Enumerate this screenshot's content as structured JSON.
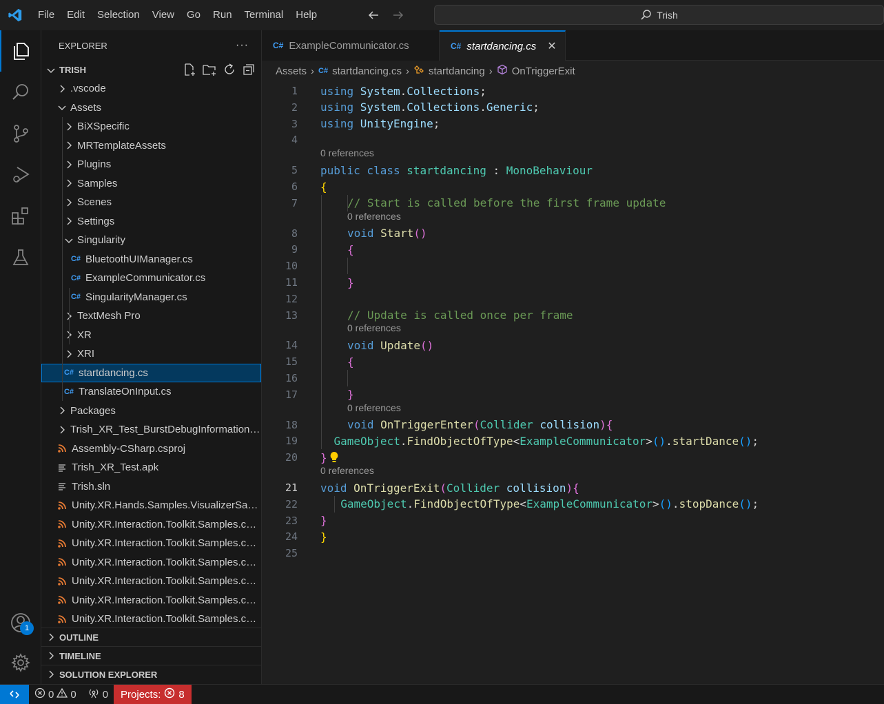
{
  "menu": [
    "File",
    "Edit",
    "Selection",
    "View",
    "Go",
    "Run",
    "Terminal",
    "Help"
  ],
  "search": {
    "label": "Trish"
  },
  "activity": {
    "accounts_badge": "1"
  },
  "sidebar": {
    "title": "EXPLORER",
    "more": "···",
    "folder": "TRISH",
    "tree": [
      {
        "label": ".vscode",
        "type": "folder",
        "depth": 1,
        "expanded": false
      },
      {
        "label": "Assets",
        "type": "folder",
        "depth": 1,
        "expanded": true
      },
      {
        "label": "BiXSpecific",
        "type": "folder",
        "depth": 2,
        "expanded": false
      },
      {
        "label": "MRTemplateAssets",
        "type": "folder",
        "depth": 2,
        "expanded": false
      },
      {
        "label": "Plugins",
        "type": "folder",
        "depth": 2,
        "expanded": false
      },
      {
        "label": "Samples",
        "type": "folder",
        "depth": 2,
        "expanded": false
      },
      {
        "label": "Scenes",
        "type": "folder",
        "depth": 2,
        "expanded": false
      },
      {
        "label": "Settings",
        "type": "folder",
        "depth": 2,
        "expanded": false
      },
      {
        "label": "Singularity",
        "type": "folder",
        "depth": 2,
        "expanded": true
      },
      {
        "label": "BluetoothUIManager.cs",
        "type": "cs",
        "depth": 3
      },
      {
        "label": "ExampleCommunicator.cs",
        "type": "cs",
        "depth": 3
      },
      {
        "label": "SingularityManager.cs",
        "type": "cs",
        "depth": 3
      },
      {
        "label": "TextMesh Pro",
        "type": "folder",
        "depth": 2,
        "expanded": false
      },
      {
        "label": "XR",
        "type": "folder",
        "depth": 2,
        "expanded": false
      },
      {
        "label": "XRI",
        "type": "folder",
        "depth": 2,
        "expanded": false
      },
      {
        "label": "startdancing.cs",
        "type": "cs",
        "depth": 2,
        "selected": true
      },
      {
        "label": "TranslateOnInput.cs",
        "type": "cs",
        "depth": 2
      },
      {
        "label": "Packages",
        "type": "folder",
        "depth": 1,
        "expanded": false
      },
      {
        "label": "Trish_XR_Test_BurstDebugInformation_DoNotShip",
        "type": "folder",
        "depth": 1,
        "expanded": false
      },
      {
        "label": "Assembly-CSharp.csproj",
        "type": "rss",
        "depth": 1
      },
      {
        "label": "Trish_XR_Test.apk",
        "type": "plain",
        "depth": 1
      },
      {
        "label": "Trish.sln",
        "type": "plain",
        "depth": 1
      },
      {
        "label": "Unity.XR.Hands.Samples.VisualizerSample.csproj",
        "type": "rss",
        "depth": 1
      },
      {
        "label": "Unity.XR.Interaction.Toolkit.Samples.csproj",
        "type": "rss",
        "depth": 1
      },
      {
        "label": "Unity.XR.Interaction.Toolkit.Samples.csproj",
        "type": "rss",
        "depth": 1
      },
      {
        "label": "Unity.XR.Interaction.Toolkit.Samples.csproj",
        "type": "rss",
        "depth": 1
      },
      {
        "label": "Unity.XR.Interaction.Toolkit.Samples.csproj",
        "type": "rss",
        "depth": 1
      },
      {
        "label": "Unity.XR.Interaction.Toolkit.Samples.csproj",
        "type": "rss",
        "depth": 1
      },
      {
        "label": "Unity.XR.Interaction.Toolkit.Samples.csproj",
        "type": "rss",
        "depth": 1
      }
    ],
    "panels": [
      "OUTLINE",
      "TIMELINE",
      "SOLUTION EXPLORER"
    ]
  },
  "tabs": [
    {
      "label": "ExampleCommunicator.cs",
      "active": false
    },
    {
      "label": "startdancing.cs",
      "active": true
    }
  ],
  "breadcrumb": [
    "Assets",
    "startdancing.cs",
    "startdancing",
    "OnTriggerExit"
  ],
  "code": {
    "lens": "0 references",
    "current_line": 21,
    "lines": [
      {
        "n": 1,
        "indent": 0,
        "tokens": [
          [
            "kw",
            "using "
          ],
          [
            "ns",
            "System"
          ],
          [
            "df",
            "."
          ],
          [
            "ns",
            "Collections"
          ],
          [
            "df",
            ";"
          ]
        ]
      },
      {
        "n": 2,
        "indent": 0,
        "tokens": [
          [
            "kw",
            "using "
          ],
          [
            "ns",
            "System"
          ],
          [
            "df",
            "."
          ],
          [
            "ns",
            "Collections"
          ],
          [
            "df",
            "."
          ],
          [
            "ns",
            "Generic"
          ],
          [
            "df",
            ";"
          ]
        ]
      },
      {
        "n": 3,
        "indent": 0,
        "tokens": [
          [
            "kw",
            "using "
          ],
          [
            "ns",
            "UnityEngine"
          ],
          [
            "df",
            ";"
          ]
        ]
      },
      {
        "n": 4,
        "indent": 0,
        "tokens": []
      },
      {
        "n": 5,
        "indent": 0,
        "lens": true,
        "tokens": [
          [
            "kw",
            "public class "
          ],
          [
            "ty",
            "startdancing"
          ],
          [
            "df",
            " : "
          ],
          [
            "ty",
            "MonoBehaviour"
          ]
        ]
      },
      {
        "n": 6,
        "indent": 0,
        "tokens": [
          [
            "br1",
            "{"
          ]
        ]
      },
      {
        "n": 7,
        "indent": 1,
        "tokens": [
          [
            "cm",
            "// Start is called before the first frame update"
          ]
        ]
      },
      {
        "n": 8,
        "indent": 1,
        "lens": true,
        "tokens": [
          [
            "kw",
            "void "
          ],
          [
            "fn",
            "Start"
          ],
          [
            "br2",
            "()"
          ]
        ]
      },
      {
        "n": 9,
        "indent": 1,
        "tokens": [
          [
            "br2",
            "{"
          ]
        ]
      },
      {
        "n": 10,
        "indent": 0,
        "tokens": []
      },
      {
        "n": 11,
        "indent": 1,
        "tokens": [
          [
            "br2",
            "}"
          ]
        ]
      },
      {
        "n": 12,
        "indent": 0,
        "tokens": []
      },
      {
        "n": 13,
        "indent": 1,
        "tokens": [
          [
            "cm",
            "// Update is called once per frame"
          ]
        ]
      },
      {
        "n": 14,
        "indent": 1,
        "lens": true,
        "tokens": [
          [
            "kw",
            "void "
          ],
          [
            "fn",
            "Update"
          ],
          [
            "br2",
            "()"
          ]
        ]
      },
      {
        "n": 15,
        "indent": 1,
        "tokens": [
          [
            "br2",
            "{"
          ]
        ]
      },
      {
        "n": 16,
        "indent": 0,
        "tokens": []
      },
      {
        "n": 17,
        "indent": 1,
        "tokens": [
          [
            "br2",
            "}"
          ]
        ]
      },
      {
        "n": 18,
        "indent": 1,
        "lens": true,
        "tokens": [
          [
            "kw",
            "void "
          ],
          [
            "fn",
            "OnTriggerEnter"
          ],
          [
            "br2",
            "("
          ],
          [
            "ty",
            "Collider "
          ],
          [
            "id",
            "collision"
          ],
          [
            "br2",
            ")"
          ],
          [
            "br2",
            "{"
          ]
        ]
      },
      {
        "n": 19,
        "indent": 0.5,
        "tokens": [
          [
            "ty",
            "GameObject"
          ],
          [
            "df",
            "."
          ],
          [
            "fn",
            "FindObjectOfType"
          ],
          [
            "df",
            "<"
          ],
          [
            "ty",
            "ExampleCommunicator"
          ],
          [
            "df",
            ">"
          ],
          [
            "br3",
            "()"
          ],
          [
            "df",
            "."
          ],
          [
            "fn",
            "startDance"
          ],
          [
            "br3",
            "()"
          ],
          [
            "df",
            ";"
          ]
        ]
      },
      {
        "n": 20,
        "indent": 0,
        "tokens": [
          [
            "br2",
            "}"
          ]
        ]
      },
      {
        "n": 21,
        "indent": 0,
        "lens": true,
        "tokens": [
          [
            "kw",
            "void "
          ],
          [
            "fn",
            "OnTriggerExit"
          ],
          [
            "br2",
            "("
          ],
          [
            "ty",
            "Collider "
          ],
          [
            "id",
            "collision"
          ],
          [
            "br2",
            ")"
          ],
          [
            "br2",
            "{"
          ]
        ]
      },
      {
        "n": 22,
        "indent": 0.75,
        "tokens": [
          [
            "ty",
            "GameObject"
          ],
          [
            "df",
            "."
          ],
          [
            "fn",
            "FindObjectOfType"
          ],
          [
            "df",
            "<"
          ],
          [
            "ty",
            "ExampleCommunicator"
          ],
          [
            "df",
            ">"
          ],
          [
            "br3",
            "()"
          ],
          [
            "df",
            "."
          ],
          [
            "fn",
            "stopDance"
          ],
          [
            "br3",
            "()"
          ],
          [
            "df",
            ";"
          ]
        ]
      },
      {
        "n": 23,
        "indent": 0,
        "tokens": [
          [
            "br2",
            "}"
          ]
        ]
      },
      {
        "n": 24,
        "indent": 0,
        "tokens": [
          [
            "br1",
            "}"
          ]
        ]
      },
      {
        "n": 25,
        "indent": 0,
        "tokens": []
      }
    ]
  },
  "status": {
    "errors": "0",
    "warnings": "0",
    "ports": "0",
    "projects_label": "Projects:",
    "projects_count": "8"
  }
}
